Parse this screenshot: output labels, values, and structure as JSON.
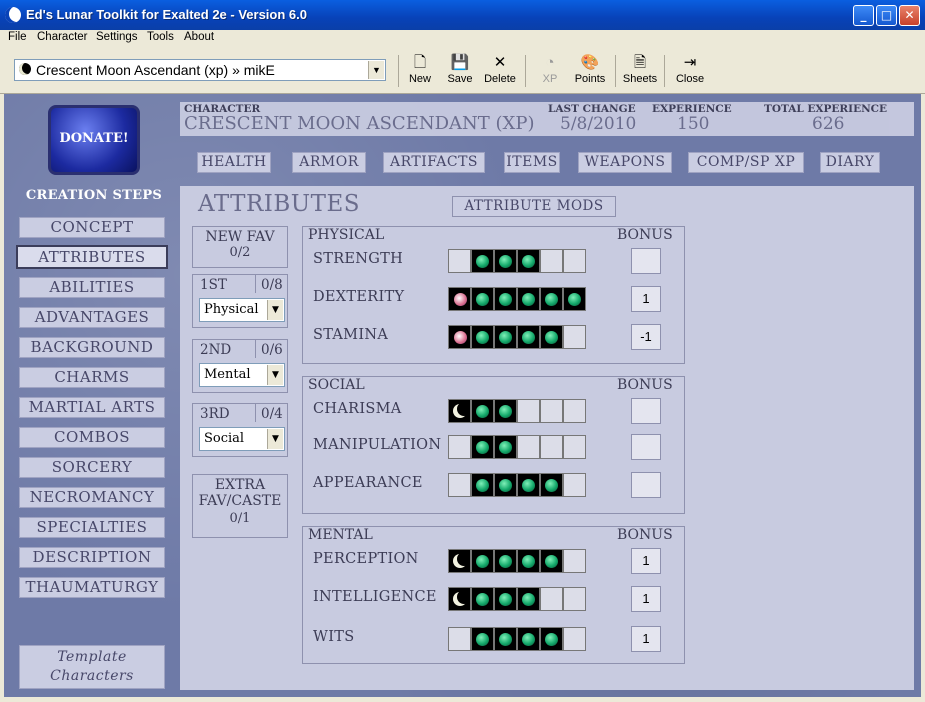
{
  "window": {
    "title": "Ed's Lunar Toolkit for Exalted 2e - Version 6.0"
  },
  "menu": [
    "File",
    "Character",
    "Settings",
    "Tools",
    "About"
  ],
  "toolbar": {
    "character_select": "Crescent Moon Ascendant (xp) » mikE",
    "buttons": {
      "new": "New",
      "save": "Save",
      "delete": "Delete",
      "xp": "XP",
      "points": "Points",
      "sheets": "Sheets",
      "close": "Close"
    }
  },
  "donate": {
    "label": "DONATE!"
  },
  "sidebar": {
    "heading": "CREATION STEPS",
    "items": [
      "CONCEPT",
      "ATTRIBUTES",
      "ABILITIES",
      "ADVANTAGES",
      "BACKGROUND",
      "CHARMS",
      "MARTIAL ARTS",
      "COMBOS",
      "SORCERY",
      "NECROMANCY",
      "SPECIALTIES",
      "DESCRIPTION",
      "THAUMATURGY"
    ],
    "template": [
      "Template",
      "Characters"
    ]
  },
  "header": {
    "character_label": "CHARACTER",
    "character_name": "CRESCENT MOON ASCENDANT (XP)",
    "last_change_label": "LAST CHANGE",
    "last_change": "5/8/2010",
    "experience_label": "EXPERIENCE",
    "experience": "150",
    "total_experience_label": "TOTAL EXPERIENCE",
    "total_experience": "626"
  },
  "tabs": [
    "HEALTH",
    "ARMOR",
    "ARTIFACTS",
    "ITEMS",
    "WEAPONS",
    "COMP/SP XP",
    "DIARY"
  ],
  "page": {
    "title": "ATTRIBUTES",
    "mods_button": "ATTRIBUTE MODS"
  },
  "priorities": {
    "new_fav_label": "NEW FAV",
    "new_fav_value": "0/2",
    "first": {
      "label": "1ST",
      "count": "0/8",
      "value": "Physical"
    },
    "second": {
      "label": "2ND",
      "count": "0/6",
      "value": "Mental"
    },
    "third": {
      "label": "3RD",
      "count": "0/4",
      "value": "Social"
    },
    "extra_label_1": "EXTRA",
    "extra_label_2": "FAV/CASTE",
    "extra_value": "0/1"
  },
  "bonus_label": "BONUS",
  "groups": [
    {
      "name": "PHYSICAL",
      "attributes": [
        {
          "name": "STRENGTH",
          "dots": 3,
          "marker": "none",
          "bonus": ""
        },
        {
          "name": "DEXTERITY",
          "dots": 5,
          "marker": "caste",
          "bonus": "1"
        },
        {
          "name": "STAMINA",
          "dots": 4,
          "marker": "caste",
          "bonus": "-1"
        }
      ]
    },
    {
      "name": "SOCIAL",
      "attributes": [
        {
          "name": "CHARISMA",
          "dots": 2,
          "marker": "moon",
          "bonus": ""
        },
        {
          "name": "MANIPULATION",
          "dots": 2,
          "marker": "none",
          "bonus": ""
        },
        {
          "name": "APPEARANCE",
          "dots": 4,
          "marker": "none",
          "bonus": ""
        }
      ]
    },
    {
      "name": "MENTAL",
      "attributes": [
        {
          "name": "PERCEPTION",
          "dots": 4,
          "marker": "moon",
          "bonus": "1"
        },
        {
          "name": "INTELLIGENCE",
          "dots": 3,
          "marker": "moon",
          "bonus": "1"
        },
        {
          "name": "WITS",
          "dots": 4,
          "marker": "none",
          "bonus": "1"
        }
      ]
    }
  ],
  "colors": {
    "title_bar": "#0842b8",
    "background": "#6e7aa7",
    "panel": "#c8cbe0",
    "dot_active": "#13a86a"
  }
}
